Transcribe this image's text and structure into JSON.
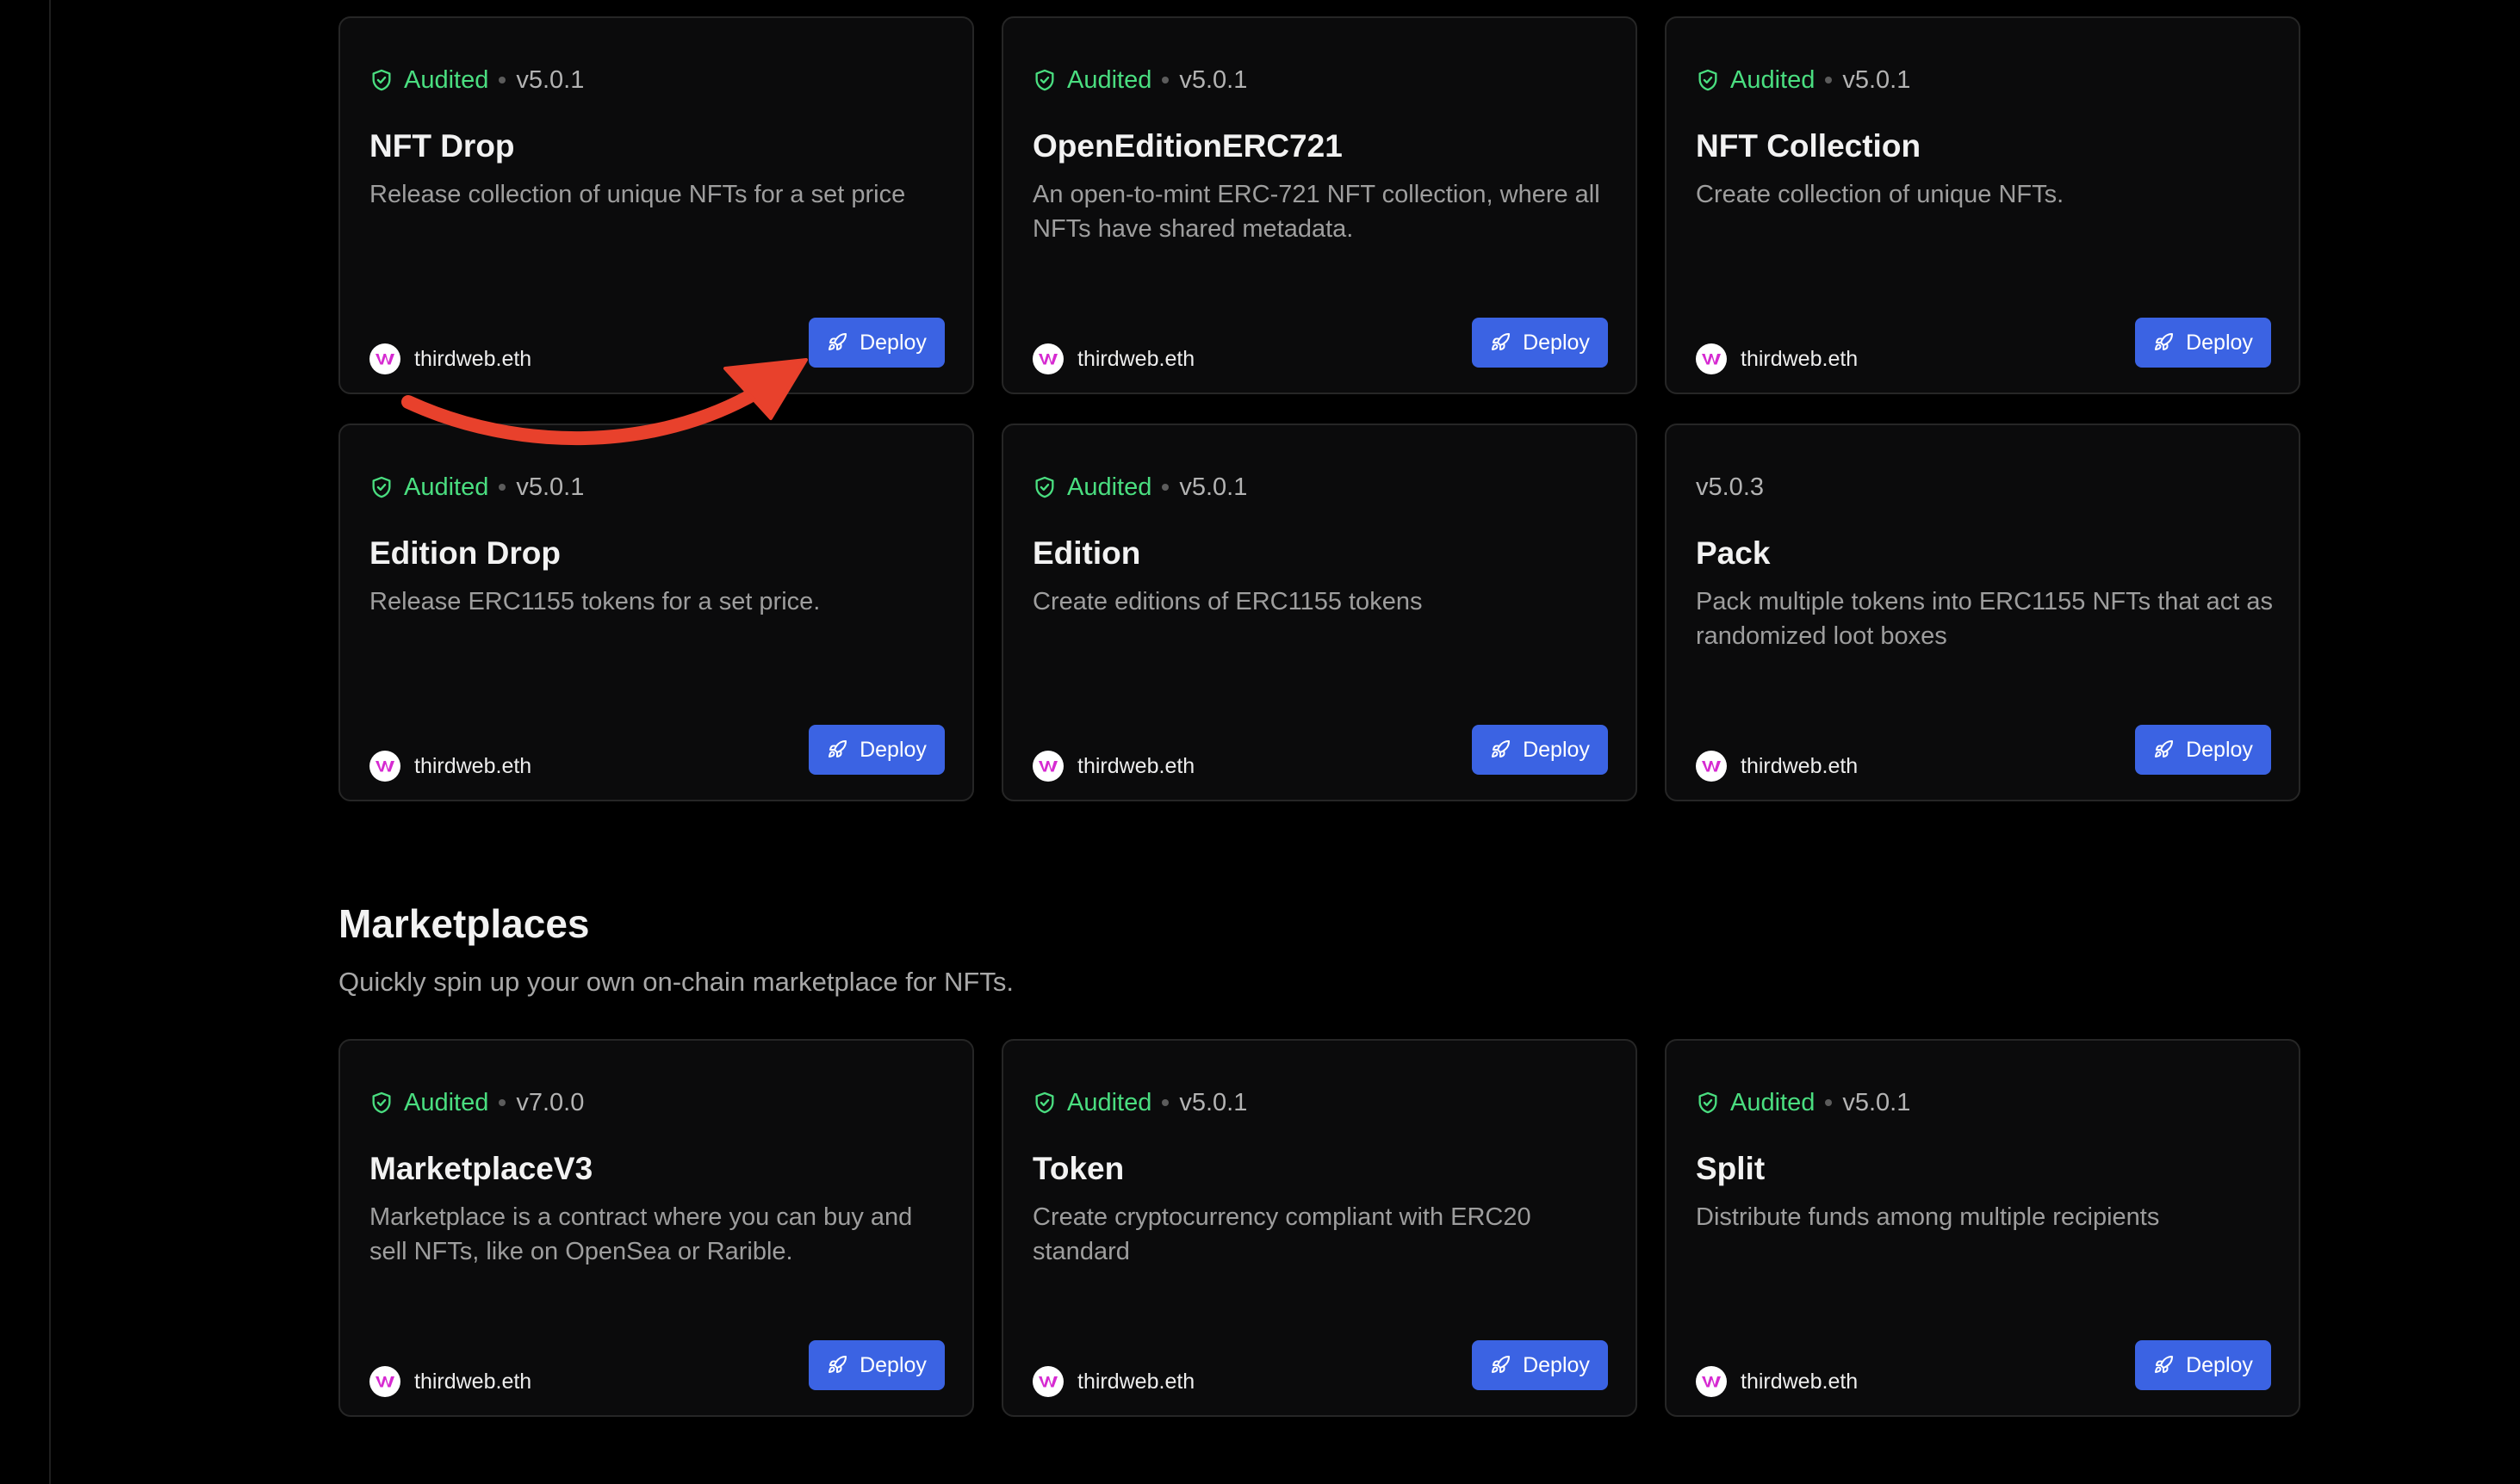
{
  "colors": {
    "background": "#000000",
    "card": "#0b0b0c",
    "audited": "#4ade80",
    "deploy_button": "#3b63e3",
    "arrow": "#e8412c"
  },
  "icons": {
    "audited": "shield-check-icon",
    "deploy": "rocket-icon",
    "publisher": "thirdweb-logo"
  },
  "top_cards": [
    {
      "audited": "Audited",
      "version": "v5.0.1",
      "title": "NFT Drop",
      "description": "Release collection of unique NFTs for a set price",
      "publisher": "thirdweb.eth",
      "deploy_label": "Deploy"
    },
    {
      "audited": "Audited",
      "version": "v5.0.1",
      "title": "OpenEditionERC721",
      "description": "An open-to-mint ERC-721 NFT collection, where all NFTs have shared metadata.",
      "publisher": "thirdweb.eth",
      "deploy_label": "Deploy"
    },
    {
      "audited": "Audited",
      "version": "v5.0.1",
      "title": "NFT Collection",
      "description": "Create collection of unique NFTs.",
      "publisher": "thirdweb.eth",
      "deploy_label": "Deploy"
    },
    {
      "audited": "Audited",
      "version": "v5.0.1",
      "title": "Edition Drop",
      "description": "Release ERC1155 tokens for a set price.",
      "publisher": "thirdweb.eth",
      "deploy_label": "Deploy"
    },
    {
      "audited": "Audited",
      "version": "v5.0.1",
      "title": "Edition",
      "description": "Create editions of ERC1155 tokens",
      "publisher": "thirdweb.eth",
      "deploy_label": "Deploy"
    },
    {
      "audited": "",
      "version": "v5.0.3",
      "title": "Pack",
      "description": "Pack multiple tokens into ERC1155 NFTs that act as randomized loot boxes",
      "publisher": "thirdweb.eth",
      "deploy_label": "Deploy"
    }
  ],
  "marketplaces": {
    "title": "Marketplaces",
    "subtitle": "Quickly spin up your own on-chain marketplace for NFTs.",
    "cards": [
      {
        "audited": "Audited",
        "version": "v7.0.0",
        "title": "MarketplaceV3",
        "description": "Marketplace is a contract where you can buy and sell NFTs, like on OpenSea or Rarible.",
        "publisher": "thirdweb.eth",
        "deploy_label": "Deploy"
      },
      {
        "audited": "Audited",
        "version": "v5.0.1",
        "title": "Token",
        "description": "Create cryptocurrency compliant with ERC20 standard",
        "publisher": "thirdweb.eth",
        "deploy_label": "Deploy"
      },
      {
        "audited": "Audited",
        "version": "v5.0.1",
        "title": "Split",
        "description": "Distribute funds among multiple recipients",
        "publisher": "thirdweb.eth",
        "deploy_label": "Deploy"
      }
    ]
  }
}
